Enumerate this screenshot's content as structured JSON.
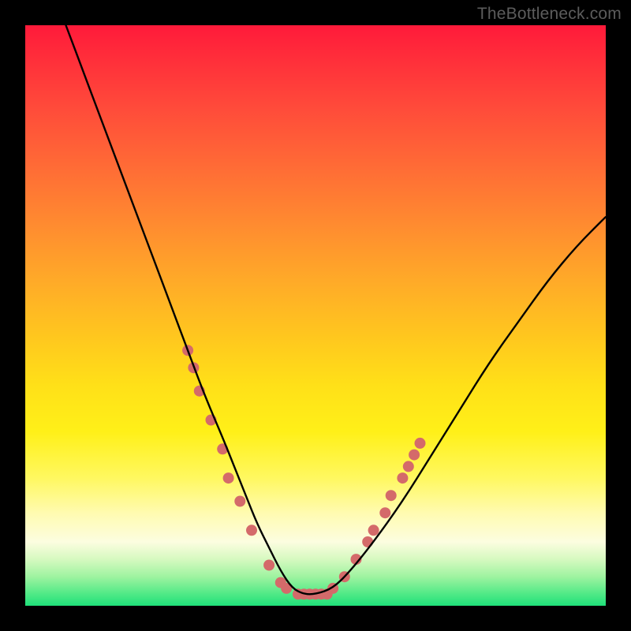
{
  "watermark": "TheBottleneck.com",
  "chart_data": {
    "type": "line",
    "title": "",
    "xlabel": "",
    "ylabel": "",
    "xlim": [
      0,
      100
    ],
    "ylim": [
      0,
      100
    ],
    "grid": false,
    "series": [
      {
        "name": "bottleneck-curve",
        "color": "#000000",
        "x": [
          7,
          10,
          13,
          16,
          19,
          22,
          25,
          28,
          31,
          34,
          36,
          38,
          40,
          42,
          44,
          46,
          48,
          50,
          53,
          56,
          60,
          65,
          70,
          75,
          80,
          85,
          90,
          95,
          100
        ],
        "y": [
          100,
          92,
          84,
          76,
          68,
          60,
          52,
          44,
          36,
          29,
          24,
          19,
          14,
          10,
          6,
          3,
          2,
          2,
          3,
          6,
          11,
          18,
          26,
          34,
          42,
          49,
          56,
          62,
          67
        ]
      }
    ],
    "markers": [
      {
        "name": "range-markers",
        "color": "#d46a6a",
        "radius_px": 7,
        "points": [
          {
            "x": 28,
            "y": 44
          },
          {
            "x": 29,
            "y": 41
          },
          {
            "x": 30,
            "y": 37
          },
          {
            "x": 32,
            "y": 32
          },
          {
            "x": 34,
            "y": 27
          },
          {
            "x": 35,
            "y": 22
          },
          {
            "x": 37,
            "y": 18
          },
          {
            "x": 39,
            "y": 13
          },
          {
            "x": 42,
            "y": 7
          },
          {
            "x": 44,
            "y": 4
          },
          {
            "x": 45,
            "y": 3
          },
          {
            "x": 47,
            "y": 2
          },
          {
            "x": 48,
            "y": 2
          },
          {
            "x": 49,
            "y": 2
          },
          {
            "x": 50,
            "y": 2
          },
          {
            "x": 51,
            "y": 2
          },
          {
            "x": 52,
            "y": 2
          },
          {
            "x": 53,
            "y": 3
          },
          {
            "x": 55,
            "y": 5
          },
          {
            "x": 57,
            "y": 8
          },
          {
            "x": 59,
            "y": 11
          },
          {
            "x": 60,
            "y": 13
          },
          {
            "x": 62,
            "y": 16
          },
          {
            "x": 63,
            "y": 19
          },
          {
            "x": 65,
            "y": 22
          },
          {
            "x": 66,
            "y": 24
          },
          {
            "x": 67,
            "y": 26
          },
          {
            "x": 68,
            "y": 28
          }
        ]
      }
    ]
  }
}
